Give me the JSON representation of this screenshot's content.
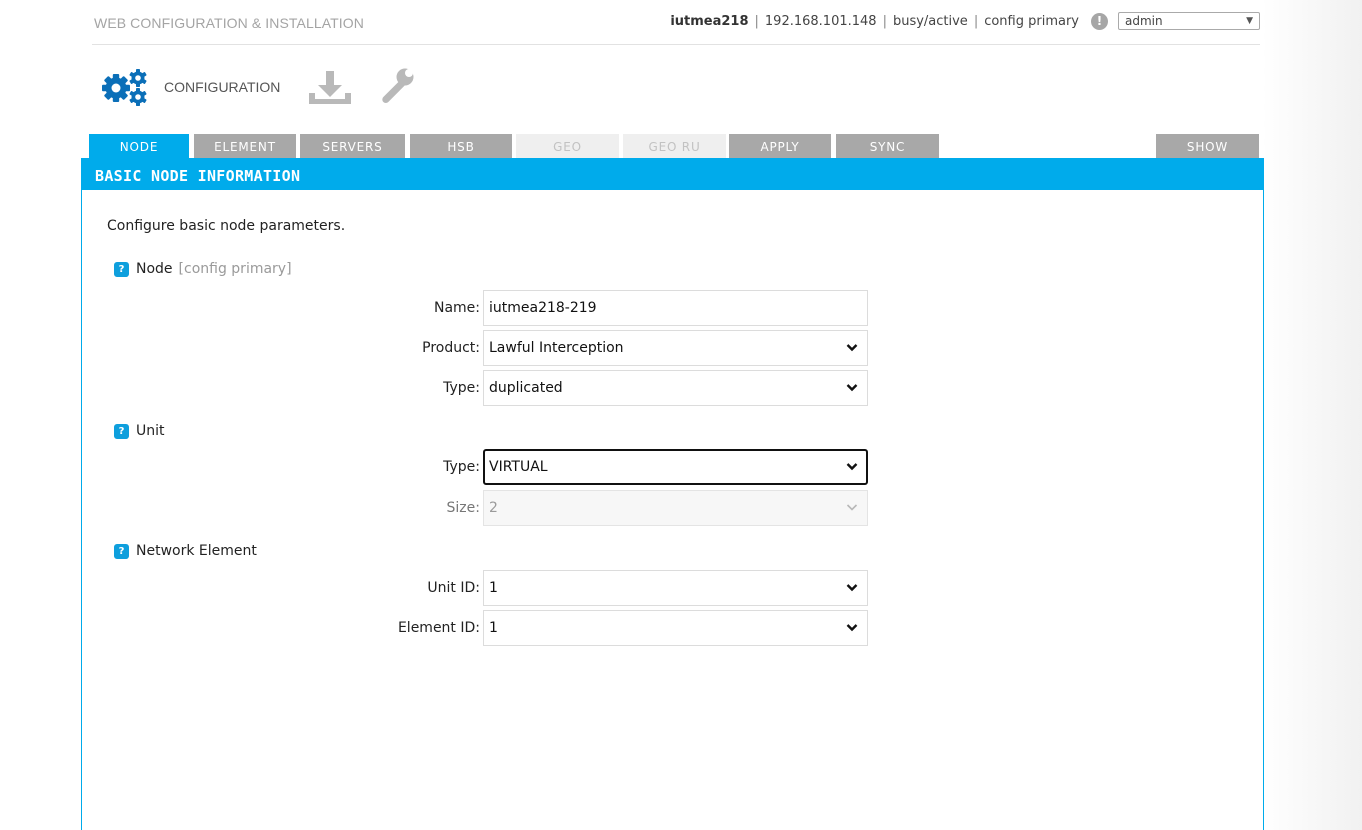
{
  "header": {
    "app_title": "WEB CONFIGURATION & INSTALLATION",
    "host": "iutmea218",
    "ip": "192.168.101.148",
    "state": "busy/active",
    "role": "config primary",
    "separator": "|",
    "alert_glyph": "!",
    "user": "admin"
  },
  "modes": {
    "configuration_label": "CONFIGURATION",
    "icons": [
      "gears-icon",
      "download-icon",
      "wrench-icon"
    ]
  },
  "tabs": [
    {
      "label": "NODE",
      "state": "active"
    },
    {
      "label": "ELEMENT",
      "state": "normal"
    },
    {
      "label": "SERVERS",
      "state": "normal"
    },
    {
      "label": "HSB",
      "state": "normal"
    },
    {
      "label": "GEO",
      "state": "disabled"
    },
    {
      "label": "GEO RU",
      "state": "disabled"
    },
    {
      "label": "APPLY",
      "state": "normal"
    },
    {
      "label": "SYNC",
      "state": "normal"
    }
  ],
  "show_tab": "SHOW",
  "panel": {
    "title": "BASIC NODE INFORMATION",
    "intro": "Configure basic node parameters.",
    "help_glyph": "?",
    "sections": {
      "node": {
        "label": "Node",
        "note": "[config primary]"
      },
      "unit": {
        "label": "Unit"
      },
      "network_element": {
        "label": "Network Element"
      }
    },
    "fields": {
      "name": {
        "label": "Name:",
        "value": "iutmea218-219"
      },
      "product": {
        "label": "Product:",
        "value": "Lawful Interception"
      },
      "node_type": {
        "label": "Type:",
        "value": "duplicated"
      },
      "unit_type": {
        "label": "Type:",
        "value": "VIRTUAL"
      },
      "unit_size": {
        "label": "Size:",
        "value": "2"
      },
      "unit_id": {
        "label": "Unit ID:",
        "value": "1"
      },
      "element_id": {
        "label": "Element ID:",
        "value": "1"
      }
    }
  },
  "colors": {
    "accent": "#00abeb",
    "tab_inactive": "#a8a8a8",
    "tab_disabled": "#efefef",
    "gear": "#0b6fb8"
  }
}
